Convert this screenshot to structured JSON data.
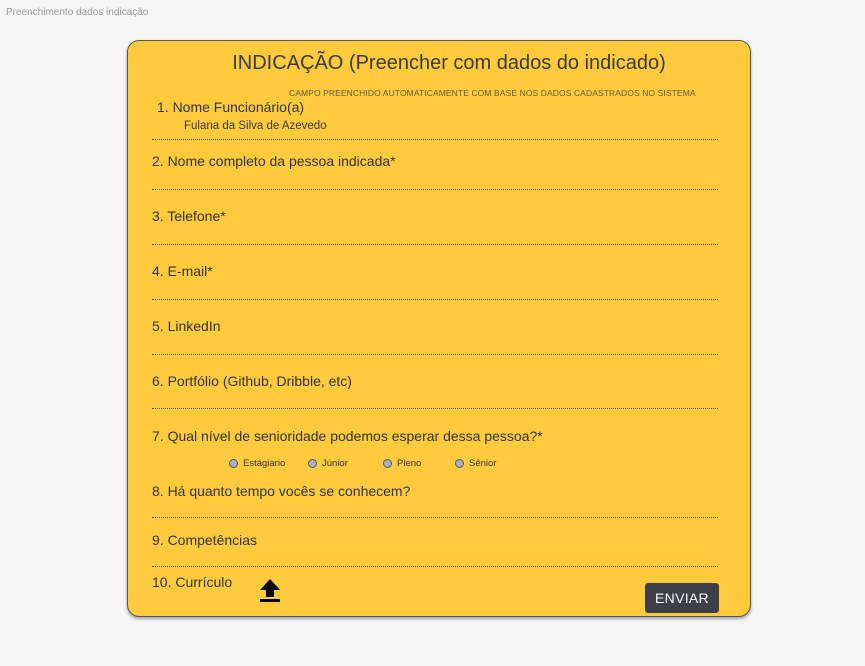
{
  "page": {
    "caption": "Preenchimento dados indicação"
  },
  "form": {
    "title": "INDICAÇÃO (Preencher com dados do indicado)",
    "auto_note": "CAMPO PREENCHIDO AUTOMATICAMENTE COM BASE NOS DADOS CADASTRADOS NO SISTEMA",
    "fields": [
      {
        "label": "1. Nome Funcionário(a)",
        "value": "Fulana da Silva de Azevedo"
      },
      {
        "label": "2. Nome completo da pessoa indicada*",
        "value": ""
      },
      {
        "label": "3. Telefone*",
        "value": ""
      },
      {
        "label": "4. E-mail*",
        "value": ""
      },
      {
        "label": "5. LinkedIn",
        "value": ""
      },
      {
        "label": "6. Portfólio (Github, Dribble, etc)",
        "value": ""
      },
      {
        "label": "7. Qual nível de senioridade podemos esperar dessa pessoa?*"
      },
      {
        "label": "8. Há quanto tempo vocês se conhecem?",
        "value": ""
      },
      {
        "label": "9. Competências",
        "value": ""
      },
      {
        "label": "10. Currículo"
      }
    ],
    "seniority_options": [
      "Estágiario",
      "Júnior",
      "Pleno",
      "Sênior"
    ],
    "upload_icon": "upload-arrow-icon",
    "submit_label": "ENVIAR",
    "colors": {
      "card_background": "#ffcb3d",
      "button_background": "#3c3f46",
      "radio_fill": "#a9b1c9"
    }
  }
}
